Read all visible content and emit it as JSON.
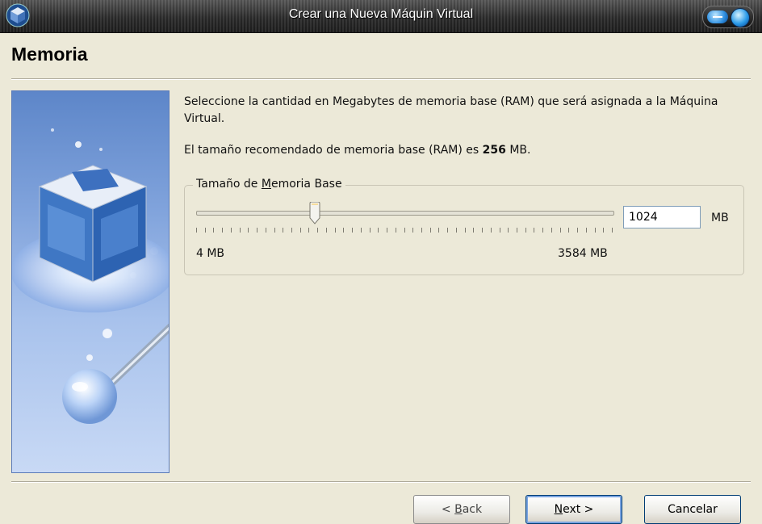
{
  "window": {
    "title": "Crear una Nueva Máquin Virtual",
    "icon": "virtualbox-cube-icon"
  },
  "page": {
    "title": "Memoria"
  },
  "description": "Seleccione la cantidad en Megabytes de memoria base (RAM) que será asignada a la Máquina Virtual.",
  "recommendation": {
    "prefix": "El tamaño recomendado de memoria base (RAM) es ",
    "value": "256",
    "suffix": " MB."
  },
  "memory_group": {
    "legend_before": "Tamaño de ",
    "legend_mnemonic": "M",
    "legend_after": "emoria Base",
    "slider": {
      "min_label": "4 MB",
      "max_label": "3584 MB",
      "min_mb": 4,
      "max_mb": 3584,
      "value_mb": 1024
    },
    "input_value": "1024",
    "unit": "MB"
  },
  "buttons": {
    "back": {
      "pre": "< ",
      "mnemonic": "B",
      "rest": "ack"
    },
    "next": {
      "mnemonic": "N",
      "rest": "ext >"
    },
    "cancel": "Cancelar"
  },
  "colors": {
    "dialog_bg": "#ece9d8",
    "titlebar": "#2b2b2b",
    "accent_blue": "#2f8fe0"
  }
}
